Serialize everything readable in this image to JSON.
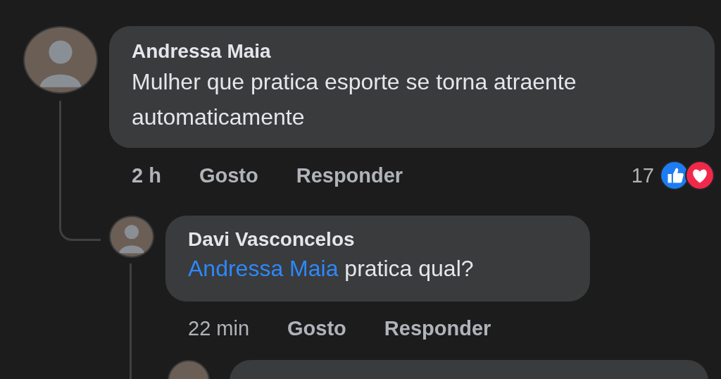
{
  "comment": {
    "author": "Andressa Maia",
    "text": "Mulher que pratica esporte se torna atraente automaticamente",
    "time": "2 h",
    "like_label": "Gosto",
    "reply_label": "Responder",
    "reaction_count": "17"
  },
  "reply": {
    "author": "Davi Vasconcelos",
    "mention": "Andressa Maia",
    "text": "pratica qual?",
    "time": "22 min",
    "like_label": "Gosto",
    "reply_label": "Responder"
  }
}
